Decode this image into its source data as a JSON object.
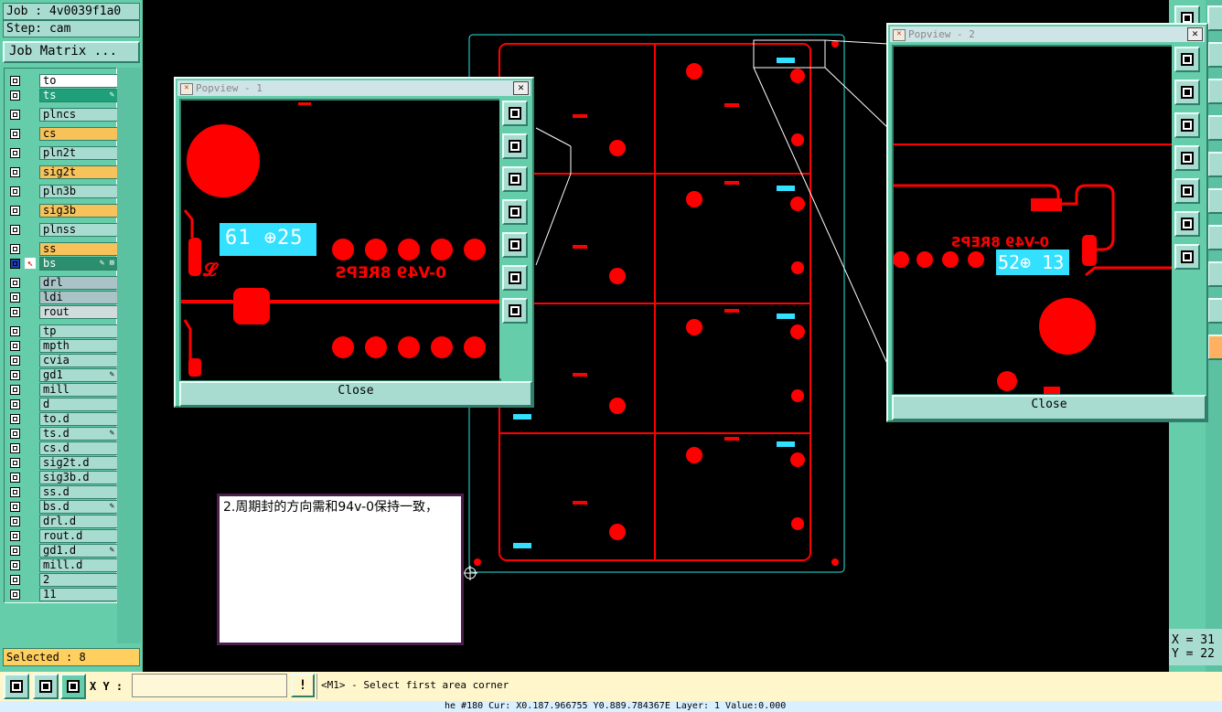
{
  "job_label": "Job : 4v0039f1a0",
  "step_label": "Step: cam",
  "job_matrix_button": "Job Matrix ...",
  "layers": [
    {
      "name": "to",
      "style": "white",
      "mark": ""
    },
    {
      "name": "ts",
      "style": "green",
      "mark": "✎"
    },
    {
      "name": "plncs",
      "style": "",
      "mark": ""
    },
    {
      "name": "cs",
      "style": "orange",
      "mark": ""
    },
    {
      "name": "pln2t",
      "style": "",
      "mark": ""
    },
    {
      "name": "sig2t",
      "style": "orange",
      "mark": ""
    },
    {
      "name": "pln3b",
      "style": "",
      "mark": ""
    },
    {
      "name": "sig3b",
      "style": "orange",
      "mark": ""
    },
    {
      "name": "plnss",
      "style": "",
      "mark": ""
    },
    {
      "name": "ss",
      "style": "orange",
      "mark": ""
    },
    {
      "name": "bs",
      "style": "sel",
      "mark": "✎ ⊞"
    },
    {
      "name": "drl",
      "style": "gray",
      "mark": ""
    },
    {
      "name": "ldi",
      "style": "gray",
      "mark": ""
    },
    {
      "name": "rout",
      "style": "lgray",
      "mark": ""
    },
    {
      "name": "tp",
      "style": "",
      "mark": ""
    },
    {
      "name": "mpth",
      "style": "",
      "mark": ""
    },
    {
      "name": "cvia",
      "style": "",
      "mark": ""
    },
    {
      "name": "gd1",
      "style": "",
      "mark": "✎"
    },
    {
      "name": "mill",
      "style": "",
      "mark": ""
    },
    {
      "name": "d",
      "style": "",
      "mark": ""
    },
    {
      "name": "to.d",
      "style": "",
      "mark": ""
    },
    {
      "name": "ts.d",
      "style": "",
      "mark": "✎"
    },
    {
      "name": "cs.d",
      "style": "",
      "mark": ""
    },
    {
      "name": "sig2t.d",
      "style": "",
      "mark": ""
    },
    {
      "name": "sig3b.d",
      "style": "",
      "mark": ""
    },
    {
      "name": "ss.d",
      "style": "",
      "mark": ""
    },
    {
      "name": "bs.d",
      "style": "",
      "mark": "✎"
    },
    {
      "name": "drl.d",
      "style": "",
      "mark": ""
    },
    {
      "name": "rout.d",
      "style": "",
      "mark": ""
    },
    {
      "name": "gd1.d",
      "style": "",
      "mark": "✎"
    },
    {
      "name": "mill.d",
      "style": "",
      "mark": ""
    },
    {
      "name": "2",
      "style": "",
      "mark": ""
    },
    {
      "name": "11",
      "style": "",
      "mark": ""
    }
  ],
  "selected_label": "Selected : 8",
  "popview1": {
    "title": "Popview - 1",
    "close_label": "Close",
    "cyan_text": "61 ⊕25",
    "mirror_text": "0-V49 8REPS"
  },
  "popview2": {
    "title": "Popview - 2",
    "close_label": "Close",
    "cyan_text": "52⊕ 13",
    "mirror_text": "0-V49 8REPS"
  },
  "note_text": "2.周期封的方向需和94v-0保持一致，",
  "bottom": {
    "xy_label": "X Y :",
    "xy_value": "",
    "exclaim": "!",
    "prompt": "<M1> - Select first area corner"
  },
  "status_line": "he #180 Cur: X0.187.966755 Y0.889.784367E Layer: 1 Value:0.000",
  "coords": {
    "x": "X = 31",
    "y": "Y = 22"
  },
  "colors": {
    "panel": "#66cdaa",
    "panel_light": "#a8dcd0",
    "copper": "#ff0000",
    "highlight_cyan": "#33e0ff",
    "note_border": "#4a1f4e"
  }
}
